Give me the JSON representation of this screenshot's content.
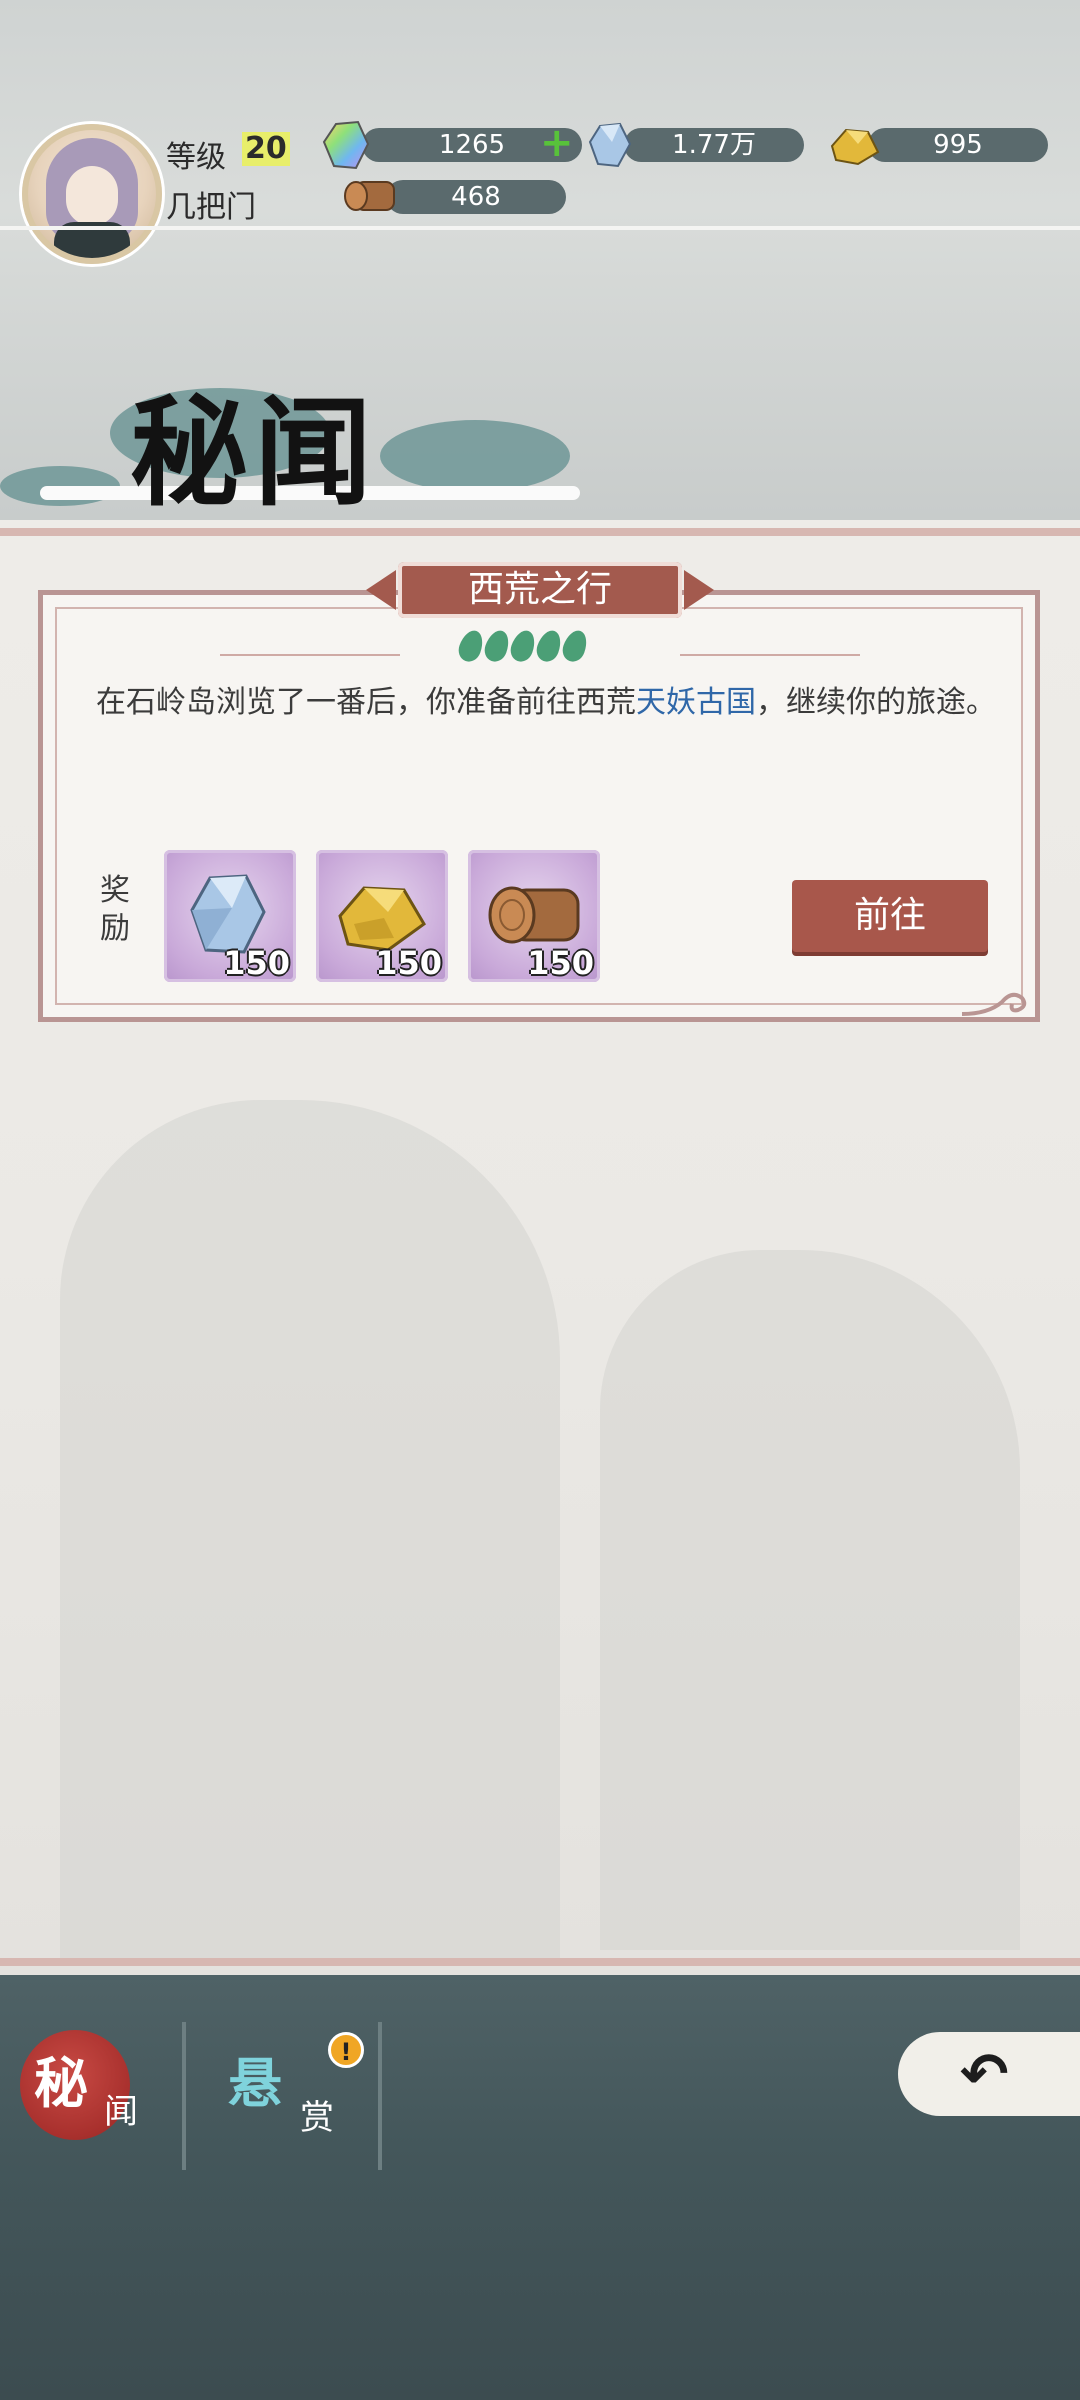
{
  "player": {
    "level_label": "等级",
    "level_value": "20",
    "sect_name": "几把门"
  },
  "resources": {
    "spirit_stone": "1265",
    "crystal": "1.77万",
    "gold": "995",
    "wood": "468"
  },
  "page_title": "秘闻",
  "quest": {
    "title": "西荒之行",
    "difficulty": 5,
    "description_before": "在石岭岛浏览了一番后，你准备前往西荒",
    "description_highlight": "天妖古国",
    "description_after": "，继续你的旅途。",
    "reward_label": "奖励",
    "rewards": [
      {
        "icon": "crystal-icon",
        "count": "150"
      },
      {
        "icon": "gold-icon",
        "count": "150"
      },
      {
        "icon": "wood-icon",
        "count": "150"
      }
    ],
    "go_button": "前往"
  },
  "nav": {
    "secret_big": "秘",
    "secret_small": "闻",
    "bounty_big": "悬",
    "bounty_small": "赏",
    "bounty_alert": "!"
  },
  "colors": {
    "accent_red": "#a8574b",
    "highlight_blue": "#2f67a8",
    "difficulty_green": "#4b9f76"
  }
}
